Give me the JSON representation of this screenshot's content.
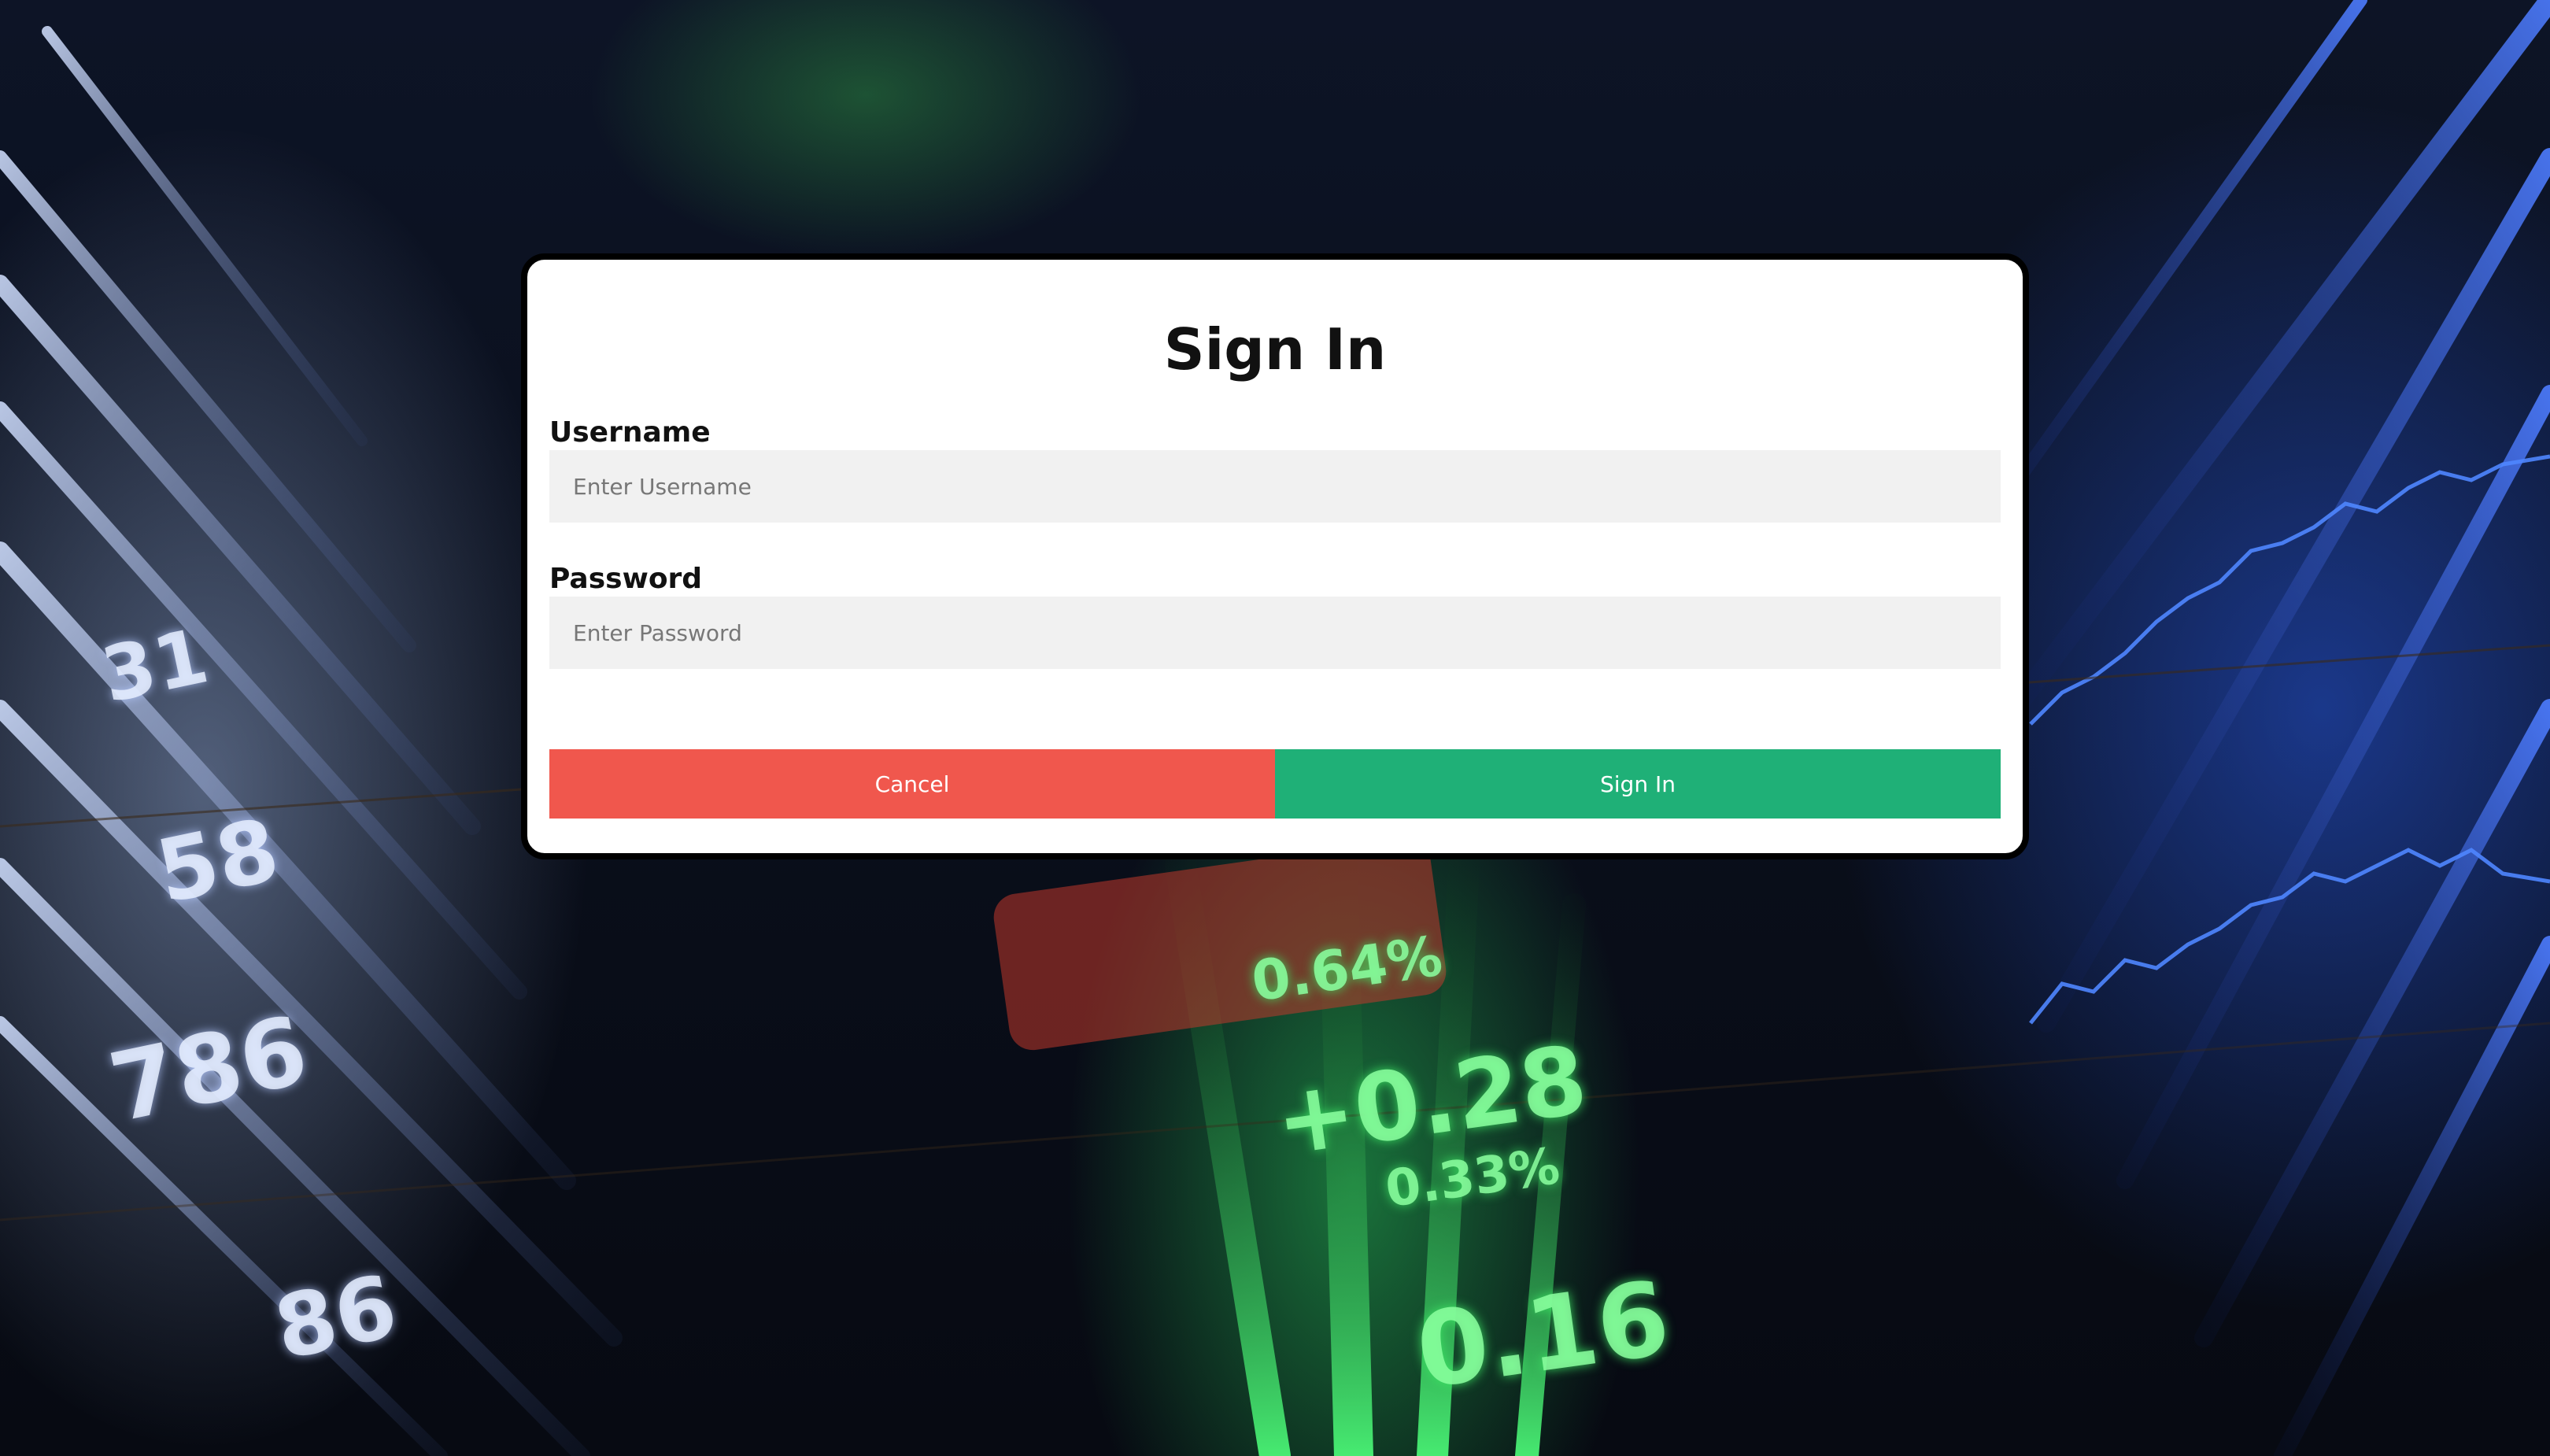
{
  "login": {
    "title": "Sign In",
    "username_label": "Username",
    "username_placeholder": "Enter Username",
    "username_value": "",
    "password_label": "Password",
    "password_placeholder": "Enter Password",
    "password_value": "",
    "cancel_label": "Cancel",
    "submit_label": "Sign In"
  },
  "colors": {
    "cancel": "#f0574d",
    "submit": "#1fb077",
    "input_bg": "#f1f1f1",
    "modal_border": "#000000"
  }
}
